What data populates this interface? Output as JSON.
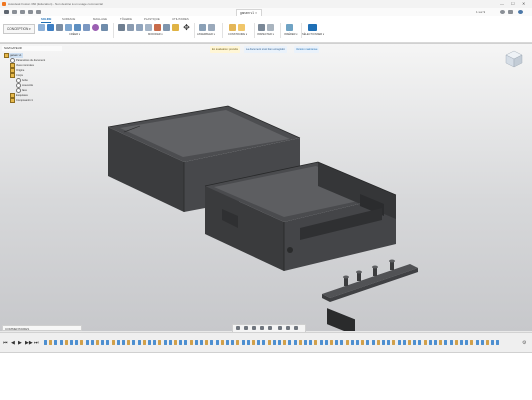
{
  "window": {
    "title": "Autodesk Fusion 360 (Education) - Non destiné à un usage commercial",
    "minimize": "—",
    "maximize": "☐",
    "close": "✕"
  },
  "document_tab": {
    "label": "ganam v1",
    "close": "✕"
  },
  "quick_access": {
    "right_status": "1 sur 9"
  },
  "ribbon": {
    "workspace_button": "CONCEPTION ▾",
    "tabs": [
      "SOLIDE",
      "SURFACE",
      "MAILLAGE",
      "TÔLERIE",
      "PLASTIQUE",
      "UTILITAIRES"
    ],
    "active_tab": 0,
    "groups": [
      {
        "label": "CRÉER ▾"
      },
      {
        "label": "MODIFIER ▾"
      },
      {
        "label": "ASSEMBLER ▾"
      },
      {
        "label": "CONSTRUIRE ▾"
      },
      {
        "label": "INSPECTER ▾"
      },
      {
        "label": "INSÉRER ▾"
      },
      {
        "label": "SÉLECTIONNER ▾"
      }
    ],
    "notices": [
      "En évaluation: prendre",
      "La document s'est bien enregistré",
      "Version maintenue"
    ]
  },
  "browser": {
    "title": "NAVIGATEUR",
    "nodes": [
      {
        "label": "ganam v1"
      },
      {
        "label": "Paramètres du document"
      },
      {
        "label": "Vues nommées"
      },
      {
        "label": "Origine"
      },
      {
        "label": "Corps"
      },
      {
        "label": "boîte"
      },
      {
        "label": "couvercle"
      },
      {
        "label": "face"
      },
      {
        "label": "Esquisses"
      },
      {
        "label": "Composant1:1"
      }
    ]
  },
  "comments": {
    "label": "COMMENTAIRES"
  },
  "colors": {
    "accent": "#1f6fb5",
    "model_dark": "#3d3e40",
    "model_light": "#5b5c5f",
    "timeline_feature": "#d1a04a",
    "timeline_sketch": "#4d8fd0"
  },
  "timeline": {
    "controls": [
      "⏮",
      "◀",
      "▶",
      "▶▶",
      "⏭"
    ],
    "settings_icon": "⚙"
  }
}
